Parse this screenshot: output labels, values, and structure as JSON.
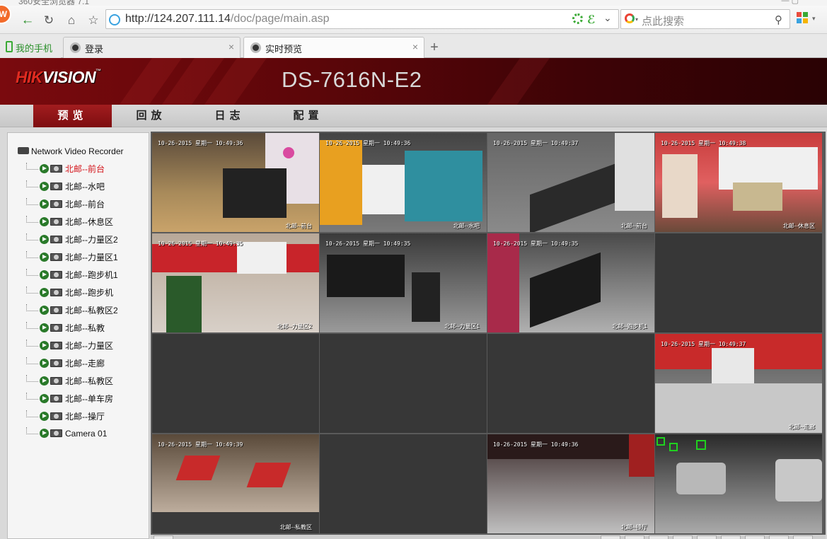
{
  "browser": {
    "title_partial": "360安全浏览器 7.1",
    "logo_text": "W",
    "url_host": "http://124.207.111.14",
    "url_path": "/doc/page/main.asp",
    "search_placeholder": "点此搜索",
    "tabs": [
      {
        "label": "我的手机",
        "closable": false
      },
      {
        "label": "登录",
        "closable": true
      },
      {
        "label": "实时预览",
        "closable": true,
        "active": true
      }
    ],
    "new_tab_label": "+",
    "close_glyph": "×"
  },
  "app": {
    "brand_hik": "HIK",
    "brand_vision": "VISION",
    "brand_tm": "™",
    "model": "DS-7616N-E2",
    "menu": [
      {
        "label": "预览",
        "active": true
      },
      {
        "label": "回放",
        "active": false
      },
      {
        "label": "日志",
        "active": false
      },
      {
        "label": "配置",
        "active": false
      }
    ]
  },
  "tree": {
    "root_label": "Network Video Recorder",
    "cameras": [
      {
        "label": "北邮--前台",
        "selected": true
      },
      {
        "label": "北邮--水吧"
      },
      {
        "label": "北邮--前台"
      },
      {
        "label": "北邮--休息区"
      },
      {
        "label": "北邮--力量区2"
      },
      {
        "label": "北邮--力量区1"
      },
      {
        "label": "北邮--跑步机1"
      },
      {
        "label": "北邮--跑步机"
      },
      {
        "label": "北邮--私教区2"
      },
      {
        "label": "北邮--私教"
      },
      {
        "label": "北邮--力量区"
      },
      {
        "label": "北邮--走廊"
      },
      {
        "label": "北邮--私教区"
      },
      {
        "label": "北邮--单车房"
      },
      {
        "label": "北邮--操厅"
      },
      {
        "label": "Camera 01"
      }
    ]
  },
  "video": {
    "cells": [
      {
        "ts": "10-26-2015 星期一 10:49:36",
        "ch": "北邮--前台",
        "scene": "store",
        "selected": true
      },
      {
        "ts": "10-26-2015 星期一 10:49:36",
        "ch": "北邮--水吧",
        "scene": "bar"
      },
      {
        "ts": "10-26-2015 星期一 10:49:37",
        "ch": "北邮--前台",
        "scene": "counter"
      },
      {
        "ts": "10-26-2015 星期一 10:49:38",
        "ch": "北邮--休息区",
        "scene": "lounge"
      },
      {
        "ts": "10-26-2015 星期一 10:49:35",
        "ch": "北邮--力量区2",
        "scene": "banners"
      },
      {
        "ts": "10-26-2015 星期一 10:49:35",
        "ch": "北邮--力量区1",
        "scene": "gym"
      },
      {
        "ts": "10-26-2015 星期一 10:49:35",
        "ch": "北邮--跑步机1",
        "scene": "treadmill"
      },
      {
        "empty": true
      },
      {
        "empty": true
      },
      {
        "empty": true
      },
      {
        "empty": true
      },
      {
        "ts": "10-26-2015 星期一 10:49:37",
        "ch": "北邮--走廊",
        "scene": "hall"
      },
      {
        "ts": "10-26-2015 星期一 10:49:39",
        "ch": "北邮--私教区",
        "scene": "mats"
      },
      {
        "empty": true
      },
      {
        "ts": "10-26-2015 星期一 10:49:36",
        "ch": "北邮--操厅",
        "scene": "class"
      },
      {
        "ts": "",
        "ch": "",
        "scene": "parking"
      }
    ]
  },
  "colors": {
    "header_red": "#7a0a0e",
    "menu_active": "#a21d1f",
    "tree_selected": "#d4141a",
    "cell_highlight": "#d8b23a",
    "empty_cell": "#373737"
  }
}
